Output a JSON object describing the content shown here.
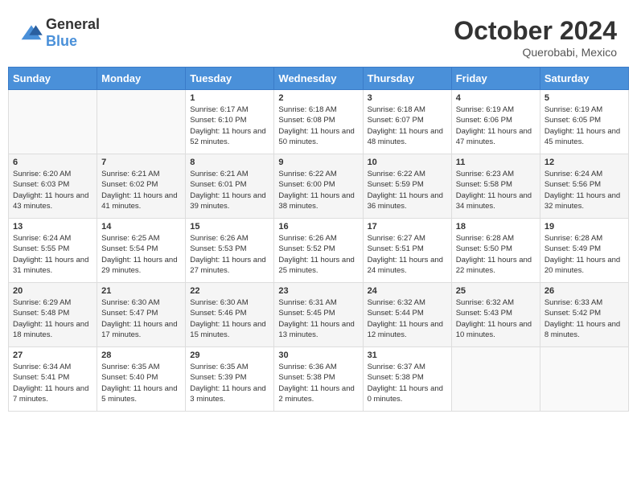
{
  "header": {
    "logo_general": "General",
    "logo_blue": "Blue",
    "month": "October 2024",
    "location": "Querobabi, Mexico"
  },
  "weekdays": [
    "Sunday",
    "Monday",
    "Tuesday",
    "Wednesday",
    "Thursday",
    "Friday",
    "Saturday"
  ],
  "weeks": [
    [
      {
        "day": "",
        "info": ""
      },
      {
        "day": "",
        "info": ""
      },
      {
        "day": "1",
        "sunrise": "6:17 AM",
        "sunset": "6:10 PM",
        "daylight": "11 hours and 52 minutes."
      },
      {
        "day": "2",
        "sunrise": "6:18 AM",
        "sunset": "6:08 PM",
        "daylight": "11 hours and 50 minutes."
      },
      {
        "day": "3",
        "sunrise": "6:18 AM",
        "sunset": "6:07 PM",
        "daylight": "11 hours and 48 minutes."
      },
      {
        "day": "4",
        "sunrise": "6:19 AM",
        "sunset": "6:06 PM",
        "daylight": "11 hours and 47 minutes."
      },
      {
        "day": "5",
        "sunrise": "6:19 AM",
        "sunset": "6:05 PM",
        "daylight": "11 hours and 45 minutes."
      }
    ],
    [
      {
        "day": "6",
        "sunrise": "6:20 AM",
        "sunset": "6:03 PM",
        "daylight": "11 hours and 43 minutes."
      },
      {
        "day": "7",
        "sunrise": "6:21 AM",
        "sunset": "6:02 PM",
        "daylight": "11 hours and 41 minutes."
      },
      {
        "day": "8",
        "sunrise": "6:21 AM",
        "sunset": "6:01 PM",
        "daylight": "11 hours and 39 minutes."
      },
      {
        "day": "9",
        "sunrise": "6:22 AM",
        "sunset": "6:00 PM",
        "daylight": "11 hours and 38 minutes."
      },
      {
        "day": "10",
        "sunrise": "6:22 AM",
        "sunset": "5:59 PM",
        "daylight": "11 hours and 36 minutes."
      },
      {
        "day": "11",
        "sunrise": "6:23 AM",
        "sunset": "5:58 PM",
        "daylight": "11 hours and 34 minutes."
      },
      {
        "day": "12",
        "sunrise": "6:24 AM",
        "sunset": "5:56 PM",
        "daylight": "11 hours and 32 minutes."
      }
    ],
    [
      {
        "day": "13",
        "sunrise": "6:24 AM",
        "sunset": "5:55 PM",
        "daylight": "11 hours and 31 minutes."
      },
      {
        "day": "14",
        "sunrise": "6:25 AM",
        "sunset": "5:54 PM",
        "daylight": "11 hours and 29 minutes."
      },
      {
        "day": "15",
        "sunrise": "6:26 AM",
        "sunset": "5:53 PM",
        "daylight": "11 hours and 27 minutes."
      },
      {
        "day": "16",
        "sunrise": "6:26 AM",
        "sunset": "5:52 PM",
        "daylight": "11 hours and 25 minutes."
      },
      {
        "day": "17",
        "sunrise": "6:27 AM",
        "sunset": "5:51 PM",
        "daylight": "11 hours and 24 minutes."
      },
      {
        "day": "18",
        "sunrise": "6:28 AM",
        "sunset": "5:50 PM",
        "daylight": "11 hours and 22 minutes."
      },
      {
        "day": "19",
        "sunrise": "6:28 AM",
        "sunset": "5:49 PM",
        "daylight": "11 hours and 20 minutes."
      }
    ],
    [
      {
        "day": "20",
        "sunrise": "6:29 AM",
        "sunset": "5:48 PM",
        "daylight": "11 hours and 18 minutes."
      },
      {
        "day": "21",
        "sunrise": "6:30 AM",
        "sunset": "5:47 PM",
        "daylight": "11 hours and 17 minutes."
      },
      {
        "day": "22",
        "sunrise": "6:30 AM",
        "sunset": "5:46 PM",
        "daylight": "11 hours and 15 minutes."
      },
      {
        "day": "23",
        "sunrise": "6:31 AM",
        "sunset": "5:45 PM",
        "daylight": "11 hours and 13 minutes."
      },
      {
        "day": "24",
        "sunrise": "6:32 AM",
        "sunset": "5:44 PM",
        "daylight": "11 hours and 12 minutes."
      },
      {
        "day": "25",
        "sunrise": "6:32 AM",
        "sunset": "5:43 PM",
        "daylight": "11 hours and 10 minutes."
      },
      {
        "day": "26",
        "sunrise": "6:33 AM",
        "sunset": "5:42 PM",
        "daylight": "11 hours and 8 minutes."
      }
    ],
    [
      {
        "day": "27",
        "sunrise": "6:34 AM",
        "sunset": "5:41 PM",
        "daylight": "11 hours and 7 minutes."
      },
      {
        "day": "28",
        "sunrise": "6:35 AM",
        "sunset": "5:40 PM",
        "daylight": "11 hours and 5 minutes."
      },
      {
        "day": "29",
        "sunrise": "6:35 AM",
        "sunset": "5:39 PM",
        "daylight": "11 hours and 3 minutes."
      },
      {
        "day": "30",
        "sunrise": "6:36 AM",
        "sunset": "5:38 PM",
        "daylight": "11 hours and 2 minutes."
      },
      {
        "day": "31",
        "sunrise": "6:37 AM",
        "sunset": "5:38 PM",
        "daylight": "11 hours and 0 minutes."
      },
      {
        "day": "",
        "info": ""
      },
      {
        "day": "",
        "info": ""
      }
    ]
  ],
  "labels": {
    "sunrise": "Sunrise:",
    "sunset": "Sunset:",
    "daylight": "Daylight:"
  }
}
